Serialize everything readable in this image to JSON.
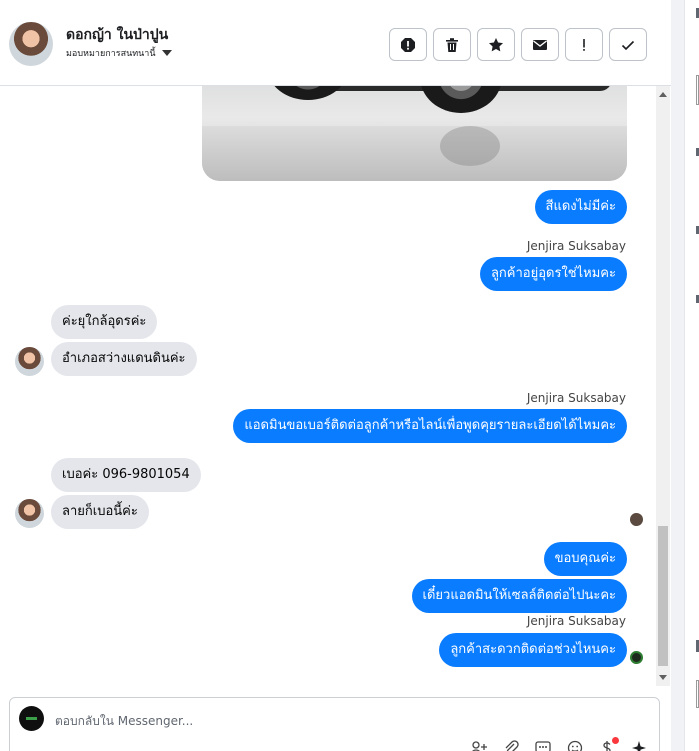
{
  "header": {
    "contact_name": "ดอกญ้า ในป่าปูน",
    "assign_label": "มอบหมายการสนทนานี้",
    "toolbar": [
      {
        "name": "spam-alert-button",
        "icon": "alert-octagon-icon"
      },
      {
        "name": "delete-button",
        "icon": "trash-icon"
      },
      {
        "name": "star-button",
        "icon": "star-icon"
      },
      {
        "name": "mark-unread-button",
        "icon": "envelope-icon"
      },
      {
        "name": "follow-up-button",
        "icon": "exclamation-icon"
      },
      {
        "name": "mark-done-button",
        "icon": "check-icon"
      }
    ]
  },
  "messages": {
    "m1": "สีแดงไม่มีค่ะ",
    "s1": "Jenjira Suksabay",
    "m2": "ลูกค้าอยู่อุดรใช่ไหมคะ",
    "m3": "ค่ะยุใกล้อุดรค่ะ",
    "m4": "อำเภอสว่างแดนดินค่ะ",
    "s2": "Jenjira Suksabay",
    "m5": "แอดมินขอเบอร์ติดต่อลูกค้าหรือไลน์เพื่อพูดคุยรายละเอียดได้ไหมคะ",
    "m6": "เบอค่ะ 096-9801054",
    "m7": "ลายก็เบอนี้ค่ะ",
    "m8": "ขอบคุณค่ะ",
    "m9": "เดี๋ยวแอดมินให้เซลล์ติดต่อไปนะคะ",
    "s3": "Jenjira Suksabay",
    "m10": "ลูกค้าสะดวกติดต่อช่วงไหนคะ"
  },
  "composer": {
    "placeholder": "ตอบกลับใน Messenger..."
  },
  "colors": {
    "outgoing_bubble": "#0a7cff",
    "incoming_bubble": "#e4e6eb"
  }
}
